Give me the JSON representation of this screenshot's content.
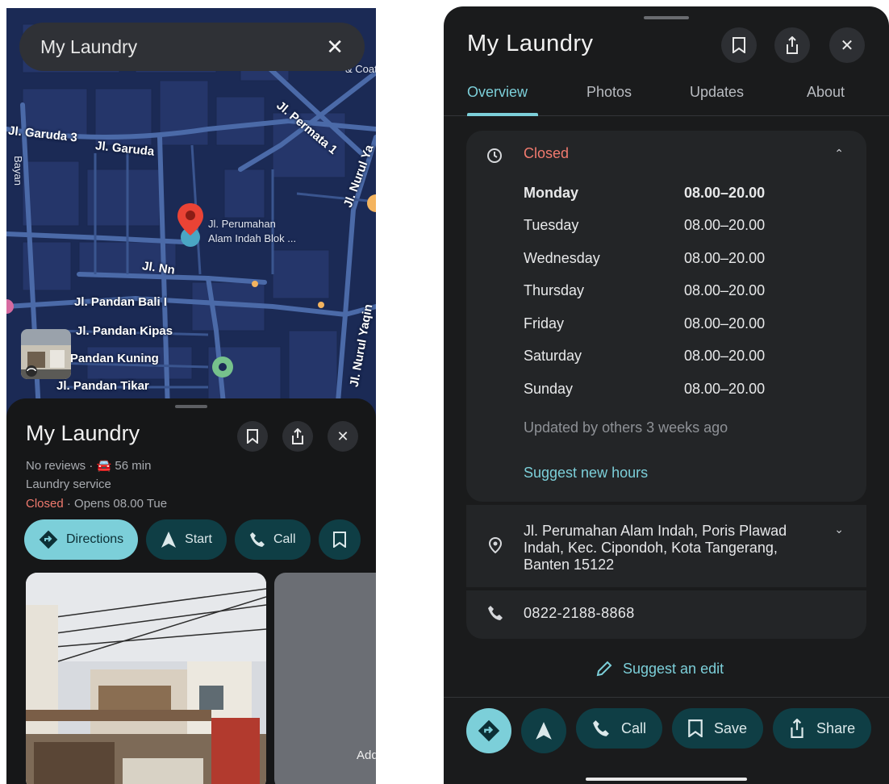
{
  "left": {
    "search": {
      "value": "My Laundry",
      "clear_icon": "close-icon"
    },
    "map_labels": {
      "jl_garuda_3": "Jl. Garuda 3",
      "jl_garuda": "Jl. Garuda",
      "jl_permata": "Jl. Permata 1",
      "jl_nurul_y": "Jl. Nurul Ya",
      "jl_nn": "Jl. Nn",
      "jl_pandan_bali": "Jl. Pandan Bali I",
      "jl_pandan_kipas": "Jl. Pandan Kipas",
      "jl_pandan_kuning": "Jl. Pandan Kuning",
      "jl_pandan_tikar": "Jl. Pandan Tikar",
      "jl_nurul_yaqin": "Jl. Nurul Yaqin",
      "coating": "& Coating",
      "bayan": "Bayan",
      "pin_label_line1": "Jl. Perumahan",
      "pin_label_line2": "Alam Indah Blok ..."
    },
    "sheet": {
      "title": "My Laundry",
      "reviews": "No reviews · ",
      "drive_time": "56 min",
      "category": "Laundry service",
      "status": "Closed",
      "opens": " · Opens 08.00 Tue",
      "actions": {
        "directions": "Directions",
        "start": "Start",
        "call": "Call"
      },
      "photo2_label": "Add"
    }
  },
  "right": {
    "title": "My Laundry",
    "tabs": [
      "Overview",
      "Photos",
      "Updates",
      "About"
    ],
    "active_tab": "Overview",
    "hours": {
      "status": "Closed",
      "rows": [
        {
          "day": "Monday",
          "time": "08.00–20.00",
          "today": true
        },
        {
          "day": "Tuesday",
          "time": "08.00–20.00"
        },
        {
          "day": "Wednesday",
          "time": "08.00–20.00"
        },
        {
          "day": "Thursday",
          "time": "08.00–20.00"
        },
        {
          "day": "Friday",
          "time": "08.00–20.00"
        },
        {
          "day": "Saturday",
          "time": "08.00–20.00"
        },
        {
          "day": "Sunday",
          "time": "08.00–20.00"
        }
      ],
      "updated": "Updated by others 3 weeks ago",
      "suggest": "Suggest new hours"
    },
    "address": "Jl. Perumahan Alam Indah, Poris Plawad Indah, Kec. Cipondoh, Kota Tangerang, Banten 15122",
    "phone": "0822-2188-8868",
    "suggest_edit": "Suggest an edit",
    "bottom_actions": {
      "call": "Call",
      "save": "Save",
      "share": "Share"
    }
  },
  "colors": {
    "accent": "#7ccfd9",
    "closed": "#f07a6e",
    "pin": "#ea4335",
    "map_bg": "#1b2a55"
  }
}
